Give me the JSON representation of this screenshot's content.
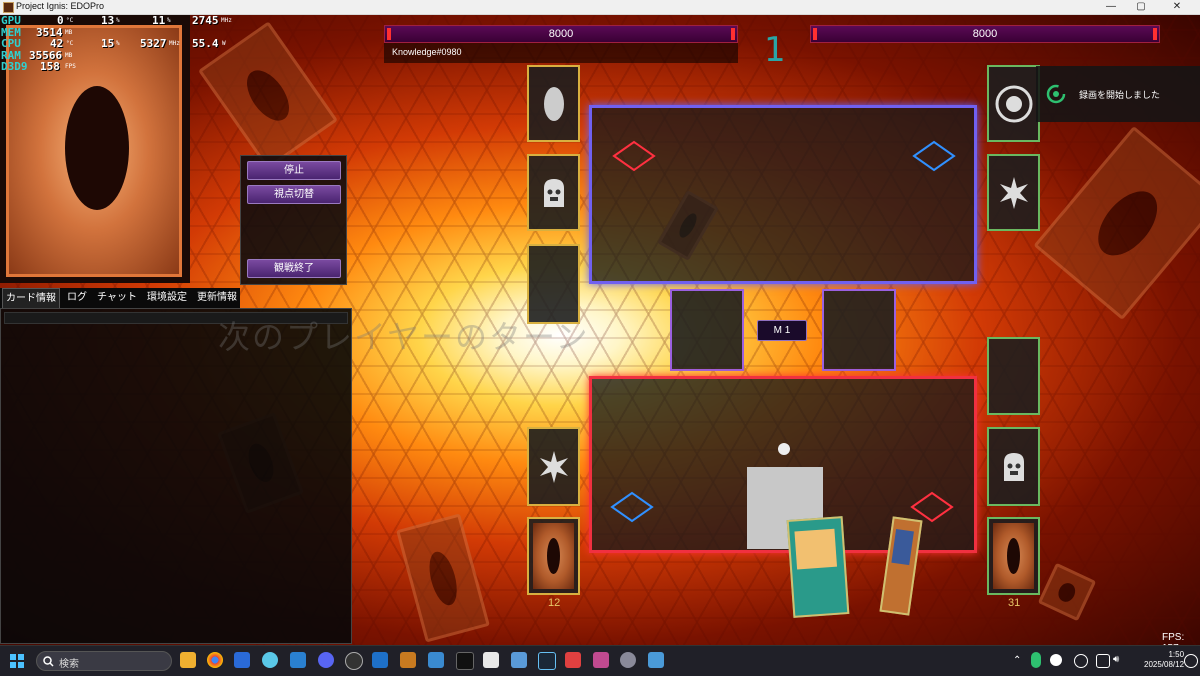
{
  "window": {
    "title": "Project Ignis: EDOPro",
    "min": "—",
    "max": "▢",
    "close": "✕"
  },
  "hw_overlay": [
    {
      "key": "GPU",
      "values": [
        {
          "v": "0",
          "u": "°C"
        },
        {
          "v": "13",
          "u": "%"
        },
        {
          "v": "11",
          "u": "%"
        },
        {
          "v": "2745",
          "u": "MHz"
        }
      ]
    },
    {
      "key": "MEM",
      "values": [
        {
          "v": "3514",
          "u": "MB"
        }
      ]
    },
    {
      "key": "CPU",
      "values": [
        {
          "v": "42",
          "u": "°C"
        },
        {
          "v": "15",
          "u": "%"
        },
        {
          "v": "5327",
          "u": "MHz"
        },
        {
          "v": "55.4",
          "u": "W"
        }
      ]
    },
    {
      "key": "RAM",
      "values": [
        {
          "v": "35566",
          "u": "MB"
        }
      ]
    },
    {
      "key": "D3D9",
      "values": [
        {
          "v": "158",
          "u": "FPS"
        }
      ]
    }
  ],
  "duel_menu": {
    "stop": "停止",
    "switch_view": "視点切替",
    "end_spectate": "観戦終了"
  },
  "tabs": [
    {
      "label": "カード情報",
      "active": true
    },
    {
      "label": "ログ"
    },
    {
      "label": "チャット"
    },
    {
      "label": "環境設定"
    },
    {
      "label": "更新情報"
    }
  ],
  "phase_banner": "次のプレイヤーのターン",
  "opponent": {
    "lp": "8000",
    "name": "Knowledge#0980"
  },
  "player": {
    "lp": "8000"
  },
  "turn": "1",
  "phase_button": "M 1",
  "counts": {
    "player_extra": "12",
    "player_deck": "31"
  },
  "notification": "録画を開始しました",
  "fps": "FPS: 157",
  "taskbar": {
    "search_label": "検索",
    "time": "1:50",
    "date": "2025/08/12"
  },
  "colors": {
    "opp_field_border": "#7060f0",
    "player_field_border": "#f03040",
    "lp_bar": "#5a0a55",
    "turn_counter": "#2aa6a6"
  }
}
